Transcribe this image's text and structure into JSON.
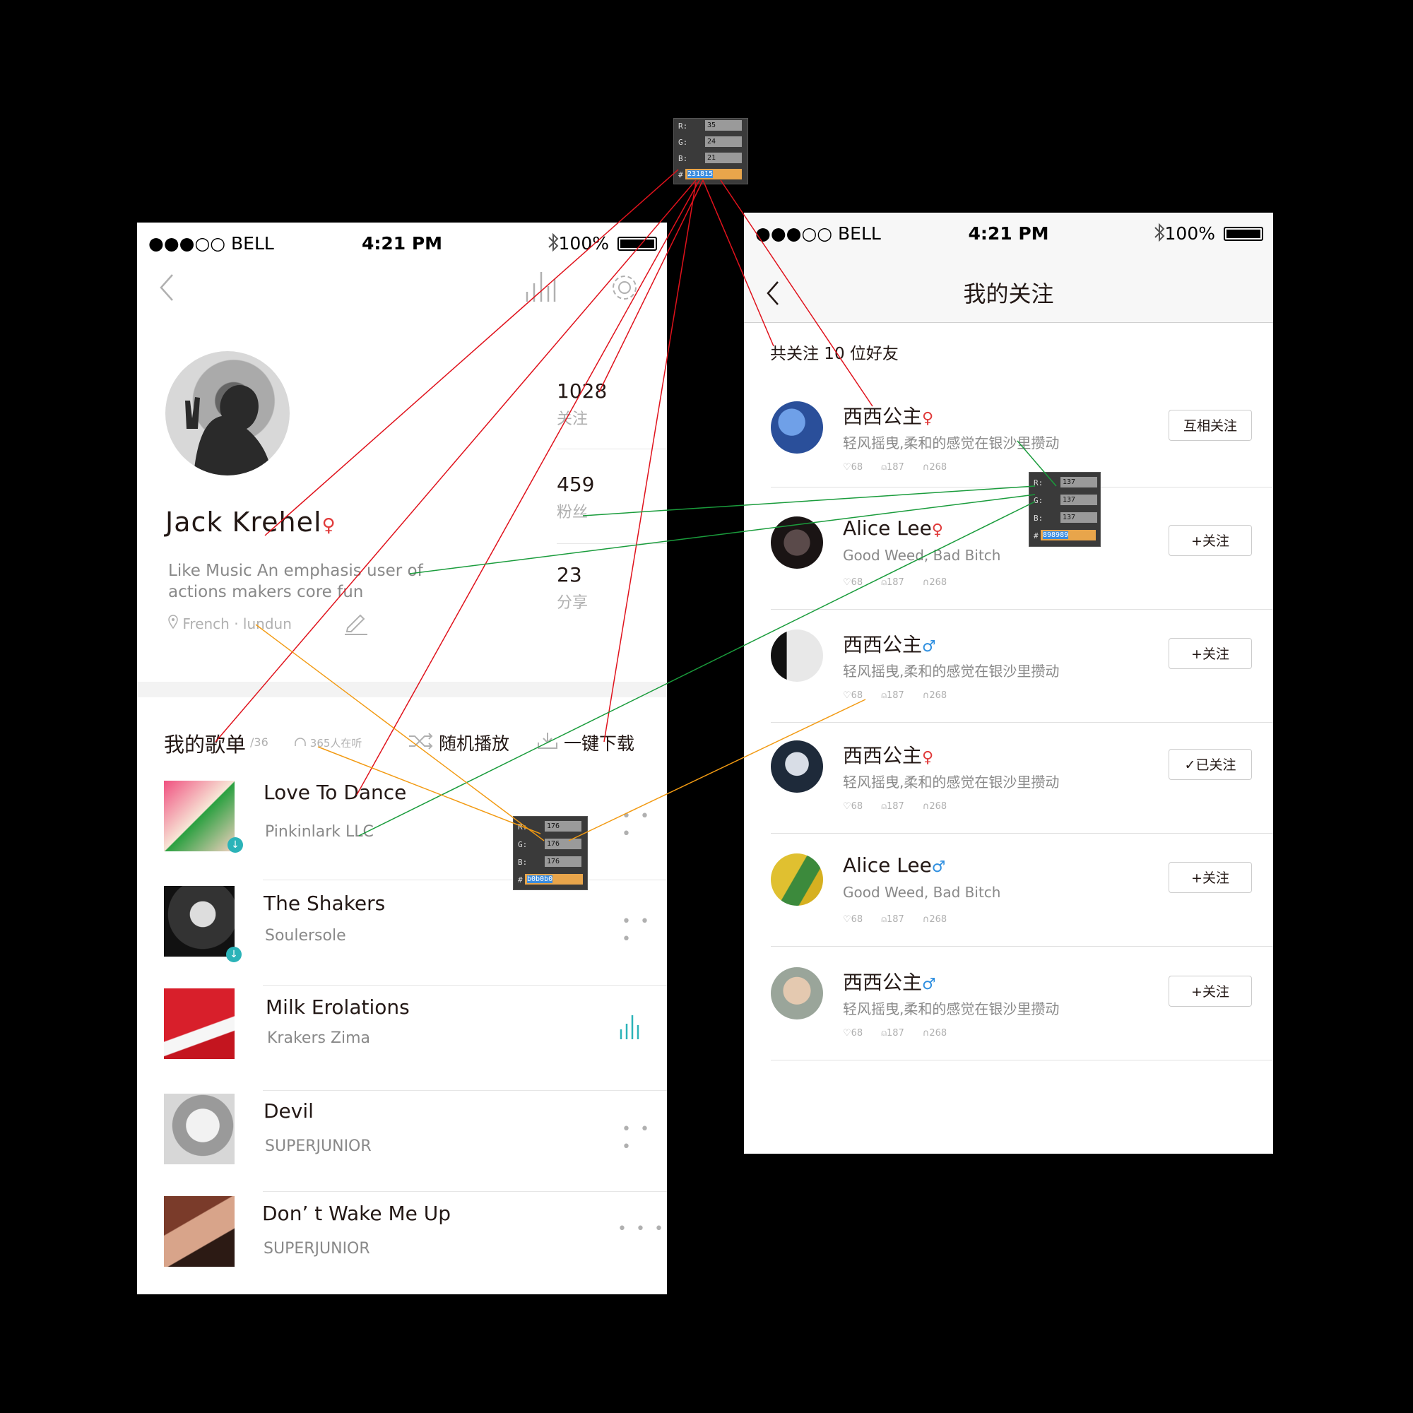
{
  "pickers": {
    "dark": {
      "r": "35",
      "g": "24",
      "b": "21",
      "hex": "231815"
    },
    "mid": {
      "r": "137",
      "g": "137",
      "b": "137",
      "hex": "898989"
    },
    "light": {
      "r": "176",
      "g": "176",
      "b": "176",
      "hex": "b0b0b0"
    }
  },
  "picker_labels": {
    "r": "R:",
    "g": "G:",
    "b": "B:",
    "hash": "#"
  },
  "colors": {
    "dark": "#231815",
    "mid": "#898989",
    "light": "#b0b0b0",
    "accent": "#2bb3b8",
    "female": "#e03a3a",
    "male": "#2f8fe0"
  },
  "status_bar": {
    "carrier": "●●●○○ BELL",
    "time": "4:21 PM",
    "battery": "100%"
  },
  "profile": {
    "name": "Jack  Krehel",
    "gender_symbol": "♀",
    "bio_line1": "Like Music An emphasis user  of",
    "bio_line2": "actions makers core fun",
    "location": "French · lundun",
    "stats": [
      {
        "value": "1028",
        "label": "关注"
      },
      {
        "value": "459",
        "label": "粉丝"
      },
      {
        "value": "23",
        "label": "分享"
      }
    ]
  },
  "playlist": {
    "title": "我的歌单",
    "count": "/36",
    "listeners": "365人在听",
    "shuffle": "随机播放",
    "download": "一键下载",
    "songs": [
      {
        "title": "Love To Dance",
        "artist": "Pinkinlark LLC"
      },
      {
        "title": "The Shakers",
        "artist": "Soulersole"
      },
      {
        "title": "Milk Erolations",
        "artist": "Krakers Zima"
      },
      {
        "title": "Devil",
        "artist": "SUPERJUNIOR"
      },
      {
        "title": "Don’ t Wake Me Up",
        "artist": "SUPERJUNIOR"
      }
    ],
    "more": "• • •"
  },
  "following": {
    "title": "我的关注",
    "summary": "共关注 10 位好友",
    "users": [
      {
        "name": "西西公主",
        "gender": "♀",
        "bio": "轻风摇曳,柔和的感觉在银沙里攒动",
        "likes": "68",
        "fans": "187",
        "listens": "268",
        "button": "互相关注"
      },
      {
        "name": "Alice Lee",
        "gender": "♀",
        "bio": "Good Weed, Bad Bitch",
        "likes": "68",
        "fans": "187",
        "listens": "268",
        "button": "+关注"
      },
      {
        "name": "西西公主",
        "gender": "♂",
        "bio": "轻风摇曳,柔和的感觉在银沙里攒动",
        "likes": "68",
        "fans": "187",
        "listens": "268",
        "button": "+关注"
      },
      {
        "name": "西西公主",
        "gender": "♀",
        "bio": "轻风摇曳,柔和的感觉在银沙里攒动",
        "likes": "68",
        "fans": "187",
        "listens": "268",
        "button": "✓已关注"
      },
      {
        "name": "Alice Lee",
        "gender": "♂",
        "bio": "Good Weed, Bad Bitch",
        "likes": "68",
        "fans": "187",
        "listens": "268",
        "button": "+关注"
      },
      {
        "name": "西西公主",
        "gender": "♂",
        "bio": "轻风摇曳,柔和的感觉在银沙里攒动",
        "likes": "68",
        "fans": "187",
        "listens": "268",
        "button": "+关注"
      }
    ]
  }
}
